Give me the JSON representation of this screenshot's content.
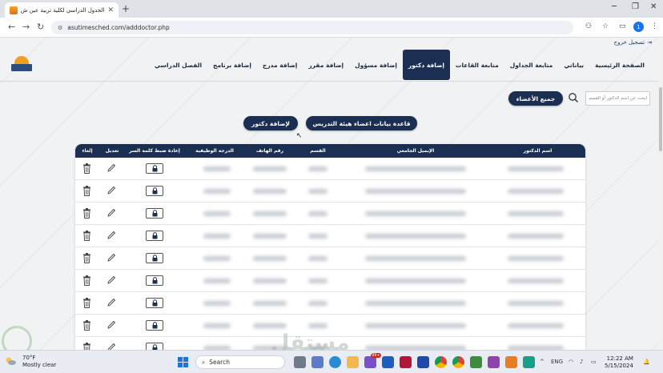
{
  "browser": {
    "tab_title": "الجدول الدراسي لكلية تربية عين ش...",
    "url": "asutimesched.com/adddoctor.php",
    "profile_initial": "1"
  },
  "page": {
    "logout_label": "تسجيل خروج",
    "nav": [
      {
        "label": "الصفحة الرئيسية",
        "active": false
      },
      {
        "label": "بياناتي",
        "active": false
      },
      {
        "label": "متابعة الجداول",
        "active": false
      },
      {
        "label": "متابعة القاعات",
        "active": false
      },
      {
        "label": "إضافة دكتور",
        "active": true
      },
      {
        "label": "إضافة مسؤول",
        "active": false
      },
      {
        "label": "إضافة مقرر",
        "active": false
      },
      {
        "label": "إضافة مدرج",
        "active": false
      },
      {
        "label": "إضافة برنامج",
        "active": false
      },
      {
        "label": "الفصل الدراسي",
        "active": false
      }
    ],
    "all_members_button": "جميع الأعضاء",
    "search_placeholder": "ابحث عن اسم الدكتور أو القسم",
    "faculty_db_button": "قاعدة بيانات اعضاء هيئة التدريس",
    "add_doctor_button": "لإضافة دكتور"
  },
  "table": {
    "headers": {
      "doctor_name": "اسم الدكتور",
      "email": "الإيميل الجامعي",
      "department": "القسم",
      "phone": "رقم الهاتف",
      "job_grade": "الدرجة الوظيفية",
      "reset_password": "إعادة ضبط كلمة السر",
      "edit": "تعديل",
      "delete": "إلغاء"
    },
    "row_count": 9
  },
  "taskbar": {
    "temperature": "70°F",
    "weather_text": "Mostly clear",
    "search_label": "Search",
    "language": "ENG",
    "time": "12:22 AM",
    "date": "5/15/2024",
    "badge": "99+"
  },
  "watermark": "مستقل"
}
